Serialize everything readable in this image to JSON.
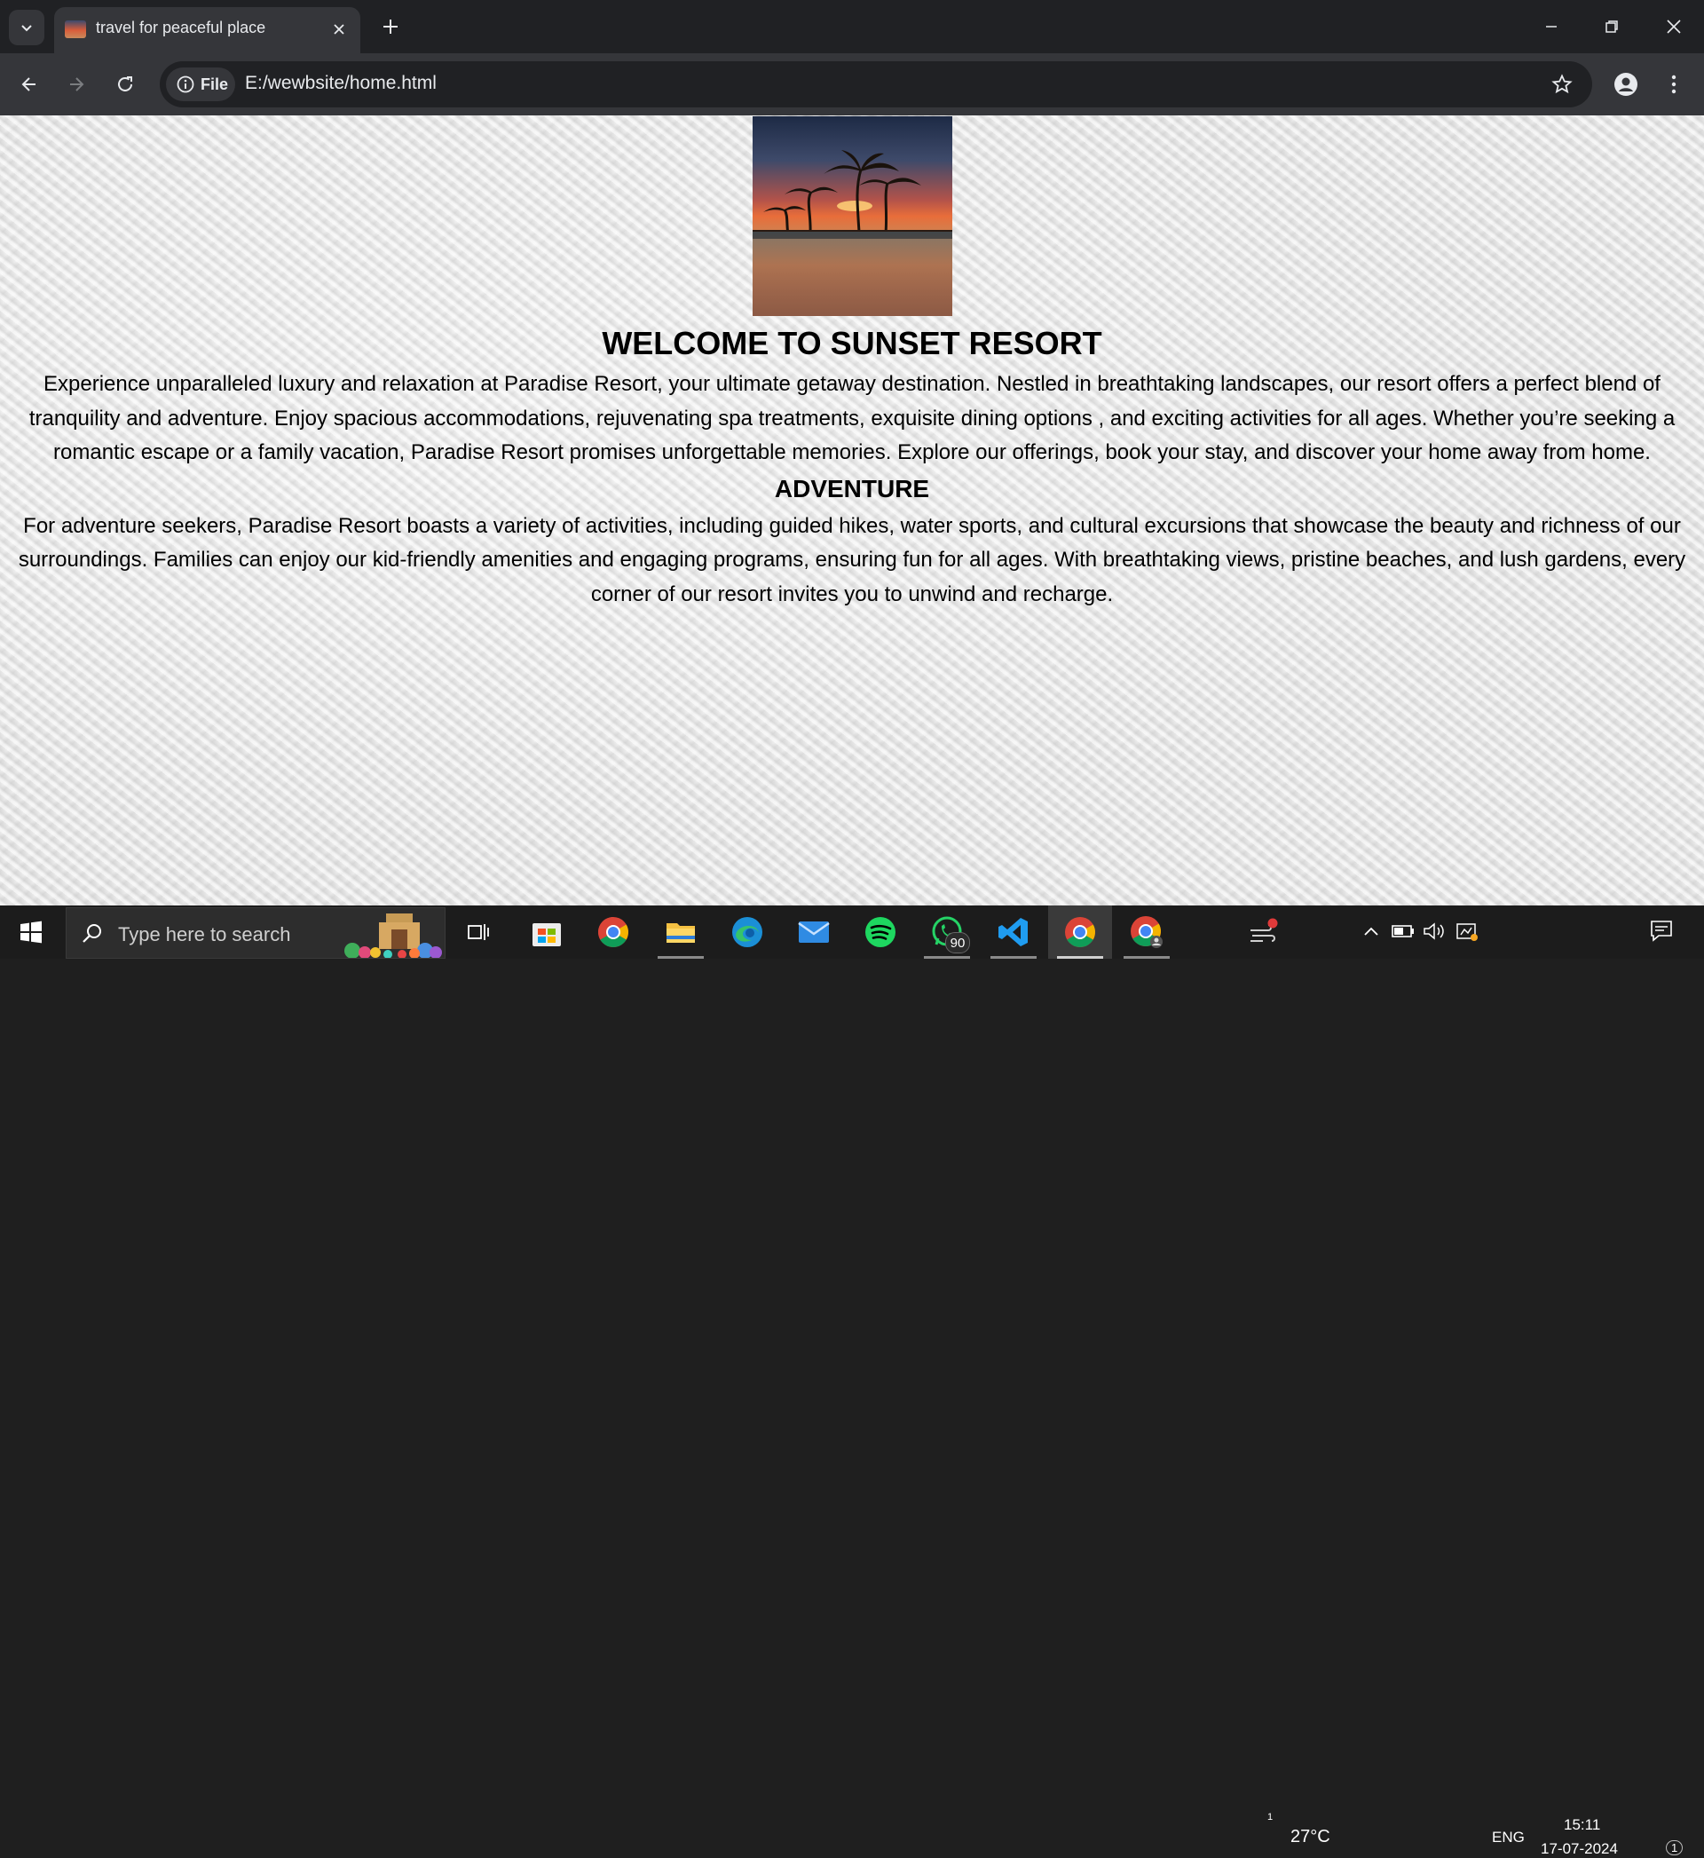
{
  "browser": {
    "tab": {
      "title": "travel for peaceful place"
    },
    "site_chip": {
      "label": "File"
    },
    "url": "E:/wewbsite/home.html"
  },
  "page": {
    "heading": "WELCOME TO SUNSET RESORT",
    "intro": "Experience unparalleled luxury and relaxation at Paradise Resort, your ultimate getaway destination. Nestled in breathtaking landscapes, our resort offers a perfect blend of tranquility and adventure. Enjoy spacious accommodations, rejuvenating spa treatments, exquisite dining options , and exciting activities for all ages. Whether you’re seeking a romantic escape or a family vacation, Paradise Resort promises unforgettable memories. Explore our offerings, book your stay, and discover your home away from home.",
    "section_heading": "ADVENTURE",
    "section_text": "For adventure seekers, Paradise Resort boasts a variety of activities, including guided hikes, water sports, and cultural excursions that showcase the beauty and richness of our surroundings. Families can enjoy our kid-friendly amenities and engaging programs, ensuring fun for all ages. With breathtaking views, pristine beaches, and lush gardens, every corner of our resort invites you to unwind and recharge."
  },
  "taskbar": {
    "search_placeholder": "Type here to search",
    "apps": [
      {
        "name": "task-view",
        "icon": "task-view-icon"
      },
      {
        "name": "microsoft-store",
        "icon": "store-icon"
      },
      {
        "name": "chrome",
        "icon": "chrome-icon"
      },
      {
        "name": "file-explorer",
        "icon": "folder-icon"
      },
      {
        "name": "edge",
        "icon": "edge-icon"
      },
      {
        "name": "mail",
        "icon": "mail-icon"
      },
      {
        "name": "spotify",
        "icon": "spotify-icon"
      },
      {
        "name": "whatsapp",
        "icon": "whatsapp-icon",
        "badge": "90"
      },
      {
        "name": "vscode",
        "icon": "vscode-icon"
      },
      {
        "name": "chrome-active",
        "icon": "chrome-icon"
      },
      {
        "name": "chrome-profile",
        "icon": "chrome-icon"
      }
    ],
    "weather": {
      "temp": "27°C",
      "alert": "1"
    },
    "language": "ENG",
    "clock": {
      "time": "15:11",
      "date": "17-07-2024"
    },
    "notifications": "1"
  },
  "colors": {
    "chrome_dark": "#202124",
    "chrome_toolbar": "#35363a",
    "taskbar": "#1c1c1c",
    "page_bg": "#e6e6e6",
    "text": "#000000"
  }
}
